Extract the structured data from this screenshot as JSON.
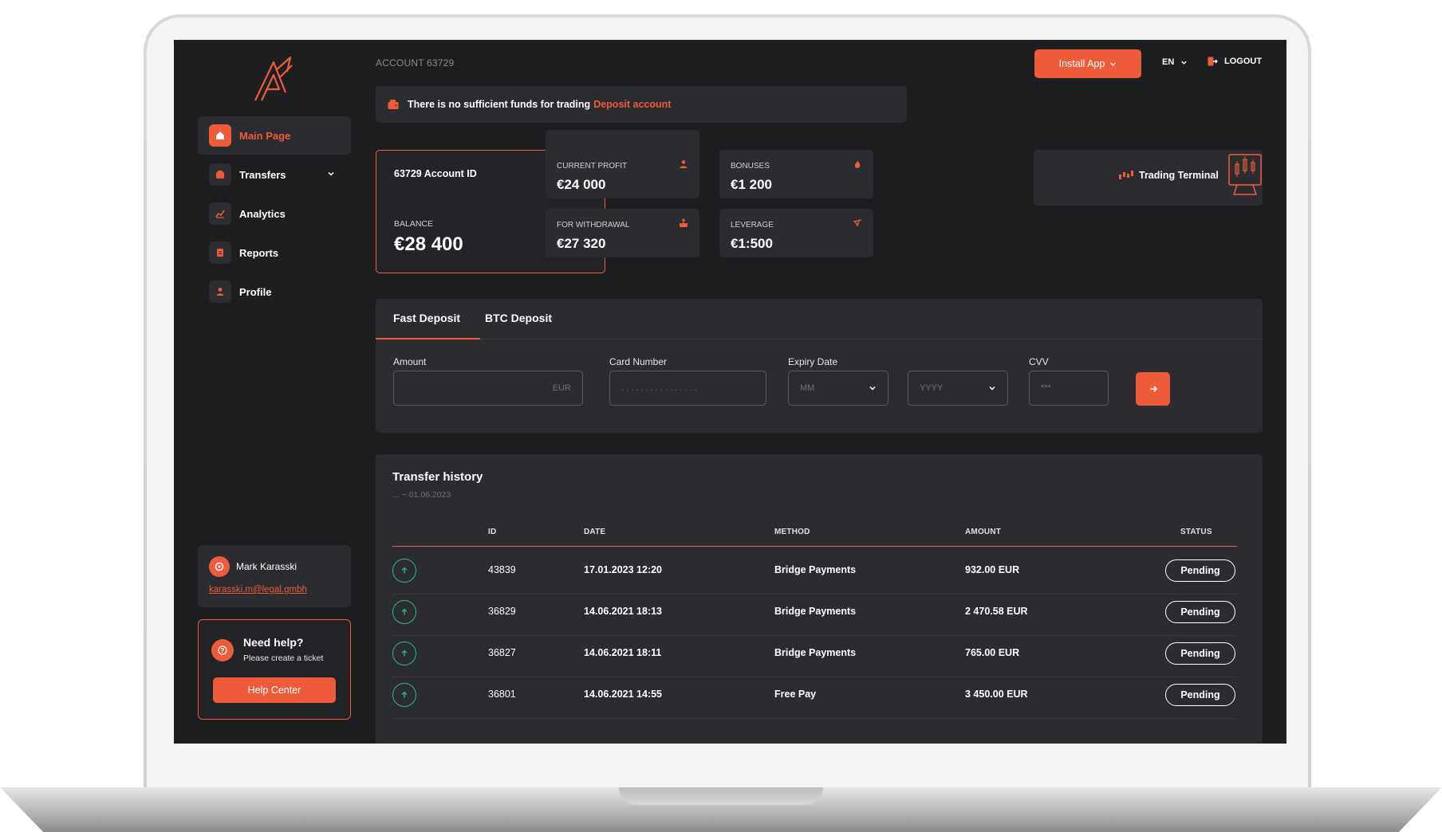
{
  "account": {
    "label": "ACCOUNT 63729"
  },
  "topbar": {
    "install_label": "Install App",
    "lang": "EN",
    "logout_label": "LOGOUT"
  },
  "alert": {
    "message": "There is no sufficient funds for trading",
    "link": "Deposit account"
  },
  "sidebar": {
    "items": [
      {
        "label": "Main Page",
        "icon": "home-icon"
      },
      {
        "label": "Transfers",
        "icon": "wallet-icon"
      },
      {
        "label": "Analytics",
        "icon": "chart-icon"
      },
      {
        "label": "Reports",
        "icon": "document-icon"
      },
      {
        "label": "Profile",
        "icon": "user-icon"
      }
    ],
    "user": {
      "name": "Mark Karasski",
      "email": "karasski.m@legal.gmbh"
    },
    "help": {
      "title": "Need help?",
      "subtitle": "Please create a ticket",
      "button": "Help Center"
    }
  },
  "balance": {
    "id": "63729 Account ID",
    "label": "BALANCE",
    "value": "€28 400"
  },
  "stats": {
    "profit": {
      "label": "CURRENT PROFIT",
      "value": "€24 000"
    },
    "bonuses": {
      "label": "BONUSES",
      "value": "€1 200"
    },
    "withdrawal": {
      "label": "FOR WITHDRAWAL",
      "value": "€27 320"
    },
    "leverage": {
      "label": "LEVERAGE",
      "value": "€1:500"
    }
  },
  "terminal": {
    "label": "Trading Terminal"
  },
  "deposit": {
    "tabs": [
      "Fast Deposit",
      "BTC Deposit"
    ],
    "fields": {
      "amount": {
        "label": "Amount",
        "placeholder": "EUR"
      },
      "card": {
        "label": "Card Number",
        "placeholder": ". . . .  . . . .  . . . .  . . . ."
      },
      "expiry": {
        "label": "Expiry Date",
        "month": "MM",
        "year": "YYYY"
      },
      "cvv": {
        "label": "CVV",
        "placeholder": "***"
      }
    }
  },
  "history": {
    "title": "Transfer history",
    "date_range": "... ~ 01.06.2023",
    "columns": [
      "ID",
      "DATE",
      "METHOD",
      "AMOUNT",
      "STATUS"
    ],
    "rows": [
      {
        "id": "43839",
        "date": "17.01.2023 12:20",
        "method": "Bridge Payments",
        "amount": "932.00 EUR",
        "status": "Pending"
      },
      {
        "id": "36829",
        "date": "14.06.2021 18:13",
        "method": "Bridge Payments",
        "amount": "2 470.58 EUR",
        "status": "Pending"
      },
      {
        "id": "36827",
        "date": "14.06.2021 18:11",
        "method": "Bridge Payments",
        "amount": "765.00 EUR",
        "status": "Pending"
      },
      {
        "id": "36801",
        "date": "14.06.2021 14:55",
        "method": "Free Pay",
        "amount": "3 450.00 EUR",
        "status": "Pending"
      }
    ]
  },
  "colors": {
    "accent": "#ee5b3b",
    "background": "#1d1e20",
    "panel": "#2b2c2f",
    "success": "#2bb77d"
  }
}
